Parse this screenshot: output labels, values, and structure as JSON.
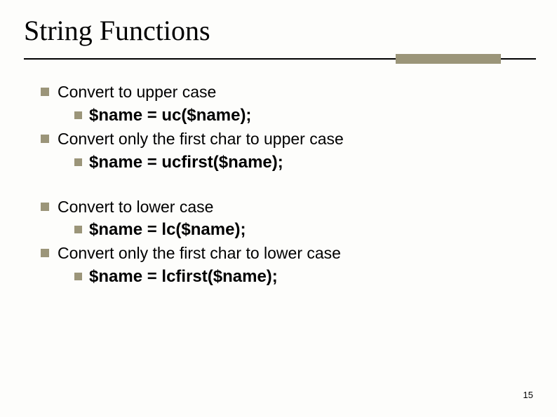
{
  "title": "String Functions",
  "bullets": {
    "g1": {
      "a": {
        "text": "Convert to upper case",
        "sub": "$name = uc($name);"
      },
      "b": {
        "text": "Convert only the first char to upper case",
        "sub": "$name = ucfirst($name);"
      }
    },
    "g2": {
      "a": {
        "text": "Convert to lower case",
        "sub": "$name = lc($name);"
      },
      "b": {
        "text": "Convert only the first char to lower case",
        "sub": "$name = lcfirst($name);"
      }
    }
  },
  "page_number": "15"
}
